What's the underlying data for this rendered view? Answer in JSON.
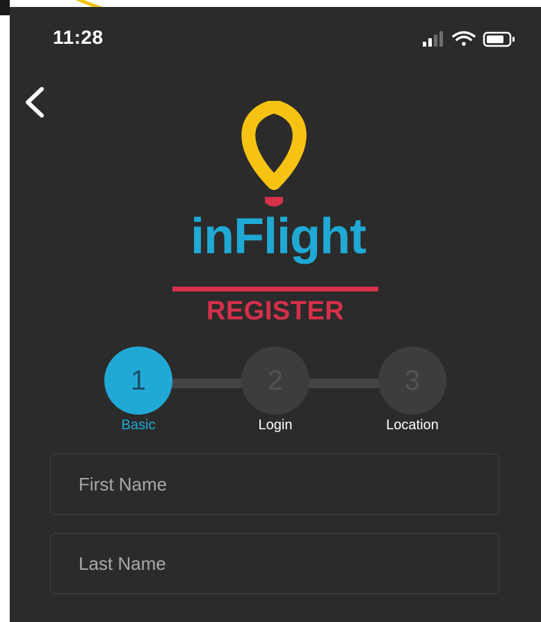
{
  "status_bar": {
    "time": "11:28"
  },
  "brand": {
    "name": "inFlight",
    "section": "REGISTER"
  },
  "stepper": {
    "steps": [
      {
        "number": "1",
        "label": "Basic",
        "active": true
      },
      {
        "number": "2",
        "label": "Login",
        "active": false
      },
      {
        "number": "3",
        "label": "Location",
        "active": false
      }
    ]
  },
  "form": {
    "first_name": {
      "placeholder": "First Name",
      "value": ""
    },
    "last_name": {
      "placeholder": "Last Name",
      "value": ""
    }
  },
  "icons": {
    "back": "chevron-left-icon",
    "signal": "cellular-signal-icon",
    "wifi": "wifi-icon",
    "battery": "battery-icon",
    "logo_pin": "location-pin-icon"
  },
  "colors": {
    "background": "#2b2b2b",
    "brand_blue": "#1fa9d4",
    "brand_red": "#d6304a",
    "brand_yellow": "#f6c313"
  }
}
